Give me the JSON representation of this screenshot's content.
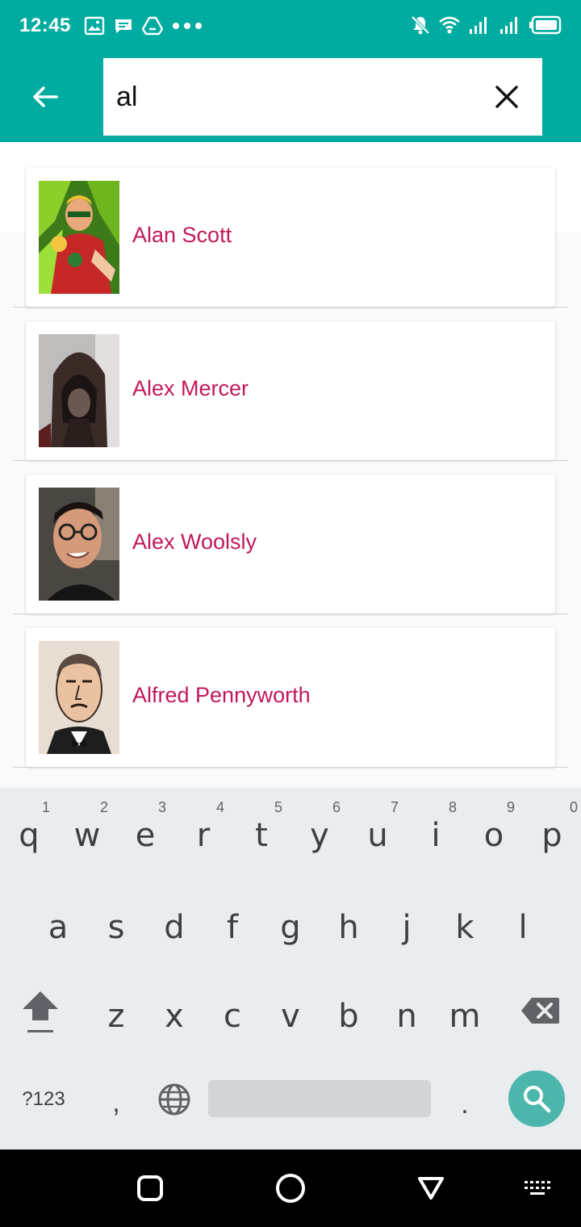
{
  "status_bar": {
    "time": "12:45",
    "left_icons": [
      "image-icon",
      "message-icon",
      "drive-icon",
      "more-dots-icon"
    ],
    "right_icons": [
      "mute-bell-icon",
      "wifi-icon",
      "signal-icon",
      "signal-icon",
      "battery-icon"
    ]
  },
  "toolbar": {
    "search_value": "al",
    "accent": "#00ab9f"
  },
  "results": [
    {
      "name": "Alan Scott",
      "image": "alan-scott-portrait"
    },
    {
      "name": "Alex Mercer",
      "image": "alex-mercer-portrait"
    },
    {
      "name": "Alex Woolsly",
      "image": "alex-woolsly-portrait"
    },
    {
      "name": "Alfred Pennyworth",
      "image": "alfred-pennyworth-portrait"
    }
  ],
  "result_text_color": "#c2185b",
  "keyboard": {
    "row1": [
      {
        "ch": "q",
        "hint": "1"
      },
      {
        "ch": "w",
        "hint": "2"
      },
      {
        "ch": "e",
        "hint": "3"
      },
      {
        "ch": "r",
        "hint": "4"
      },
      {
        "ch": "t",
        "hint": "5"
      },
      {
        "ch": "y",
        "hint": "6"
      },
      {
        "ch": "u",
        "hint": "7"
      },
      {
        "ch": "i",
        "hint": "8"
      },
      {
        "ch": "o",
        "hint": "9"
      },
      {
        "ch": "p",
        "hint": "0"
      }
    ],
    "row2": [
      "a",
      "s",
      "d",
      "f",
      "g",
      "h",
      "j",
      "k",
      "l"
    ],
    "row3": [
      "z",
      "x",
      "c",
      "v",
      "b",
      "n",
      "m"
    ],
    "symbols_label": "?123",
    "comma": ",",
    "period": ".",
    "action_color": "#4db6ac"
  }
}
